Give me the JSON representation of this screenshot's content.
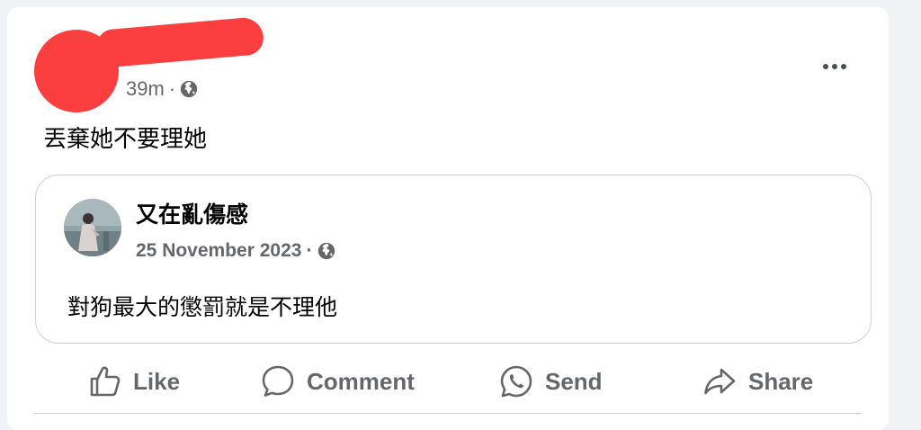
{
  "post": {
    "timestamp": "39m",
    "separator": "·",
    "visibility_icon": "globe-icon",
    "more_icon": "more-options-icon",
    "text": "丟棄她不要理她"
  },
  "shared_post": {
    "author": "又在亂傷感",
    "date": "25 November 2023",
    "separator": "·",
    "visibility_icon": "globe-icon",
    "text": "對狗最大的懲罰就是不理他"
  },
  "actions": {
    "like": "Like",
    "comment": "Comment",
    "send": "Send",
    "share": "Share"
  },
  "colors": {
    "redaction": "#fb3f3f",
    "secondary_text": "#65676b",
    "primary_text": "#050505",
    "border": "#ced0d4"
  }
}
